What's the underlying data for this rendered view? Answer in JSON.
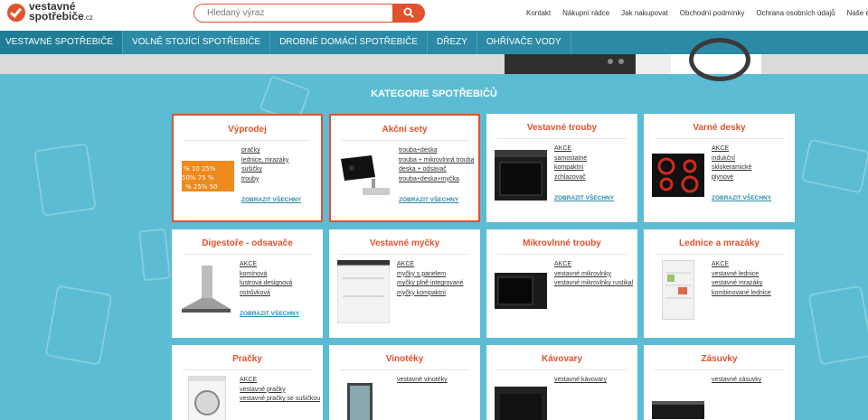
{
  "logo": {
    "line1": "vestavné",
    "line2": "spotřebiče",
    "suffix": ".cz"
  },
  "search": {
    "placeholder": "Hledaný výraz"
  },
  "top_nav": [
    "Kontakt",
    "Nákupní rádce",
    "Jak nakupovat",
    "Obchodní podmínky",
    "Ochrana osobních údajů",
    "Naše eshopy"
  ],
  "category_bar": [
    "Vestavné spotřebiče",
    "Volně stojící spotřebiče",
    "Drobné domácí spotřebiče",
    "Dřezy",
    "Ohřívače vody"
  ],
  "section_title": "Kategorie spotřebičů",
  "show_all_label": "Zobrazit všechny",
  "colors": {
    "accent": "#e0532d",
    "nav": "#2b8aa5",
    "background": "#5bbcd3"
  },
  "cards": [
    {
      "title": "Výprodej",
      "links": [
        "pračky",
        "lednice, mrazáky",
        "sušičky",
        "trouby"
      ],
      "show_all": true,
      "highlight": true
    },
    {
      "title": "Akční sety",
      "links": [
        "trouba+deska",
        "trouba + mikrovlnná trouba",
        "deska + odsavač",
        "trouba+deska+myčka"
      ],
      "show_all": true,
      "highlight": true
    },
    {
      "title": "Vestavné trouby",
      "links": [
        "AKCE",
        "samostatné",
        "kompaktní",
        "zchlazovač"
      ],
      "show_all": true,
      "highlight": false
    },
    {
      "title": "Varné desky",
      "links": [
        "AKCE",
        "indukční",
        "sklokeramické",
        "plynové"
      ],
      "show_all": true,
      "highlight": false
    },
    {
      "title": "Digestoře - odsavače",
      "links": [
        "AKCE",
        "komínová",
        "lustrová designová",
        "ostrůvková"
      ],
      "show_all": true,
      "highlight": false
    },
    {
      "title": "Vestavné myčky",
      "links": [
        "AKCE",
        "myčky s panelem",
        "myčky plně integrované",
        "myčky kompaktní"
      ],
      "show_all": false,
      "highlight": false
    },
    {
      "title": "Mikrovlnné trouby",
      "links": [
        "AKCE",
        "vestavné mikrovlnky",
        "vestavné mikrovlnky rustikal"
      ],
      "show_all": false,
      "highlight": false
    },
    {
      "title": "Lednice a mrazáky",
      "links": [
        "AKCE",
        "vestavné lednice",
        "vestavné mrazáky",
        "kombinované lednice"
      ],
      "show_all": false,
      "highlight": false
    },
    {
      "title": "Pračky",
      "links": [
        "AKCE",
        "vestavné pračky",
        "vestavné pračky se sušičkou"
      ],
      "show_all": false,
      "highlight": false
    },
    {
      "title": "Vinotéky",
      "links": [
        "vestavné vinotéky"
      ],
      "show_all": false,
      "highlight": false
    },
    {
      "title": "Kávovary",
      "links": [
        "vestavné kávovary"
      ],
      "show_all": false,
      "highlight": false
    },
    {
      "title": "Zásuvky",
      "links": [
        "vestavné zásuvky"
      ],
      "show_all": false,
      "highlight": false
    }
  ]
}
